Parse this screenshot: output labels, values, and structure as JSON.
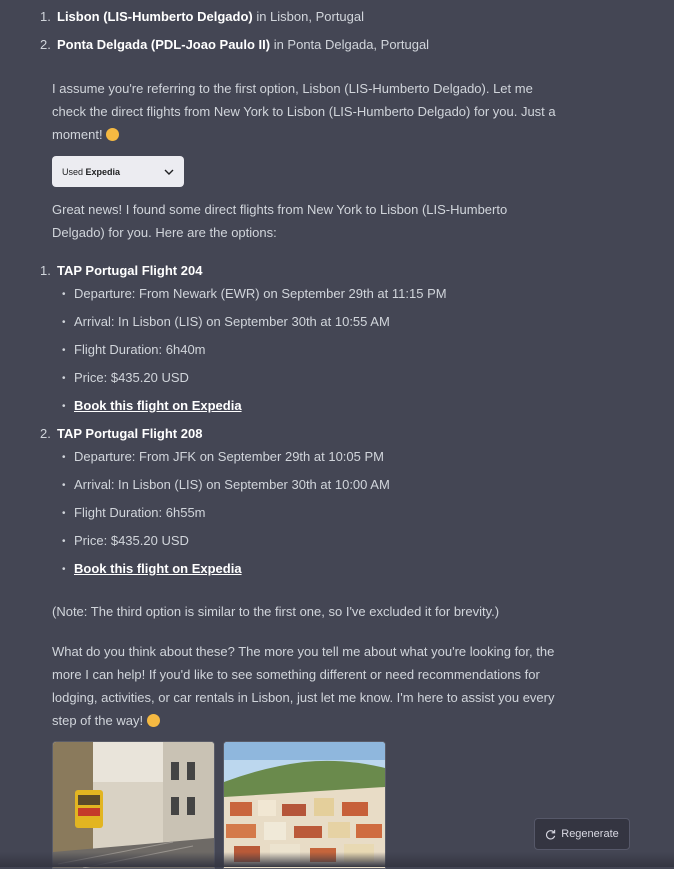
{
  "airports": [
    {
      "num": "1.",
      "name": "Lisbon (LIS-Humberto Delgado)",
      "location": " in Lisbon, Portugal"
    },
    {
      "num": "2.",
      "name": "Ponta Delgada (PDL-Joao Paulo II)",
      "location": " in Ponta Delgada, Portugal"
    }
  ],
  "assume_text": "I assume you're referring to the first option, Lisbon (LIS-Humberto Delgado). Let me check the direct flights from New York to Lisbon (LIS-Humberto Delgado) for you. Just a moment!",
  "plugin": {
    "used": "Used",
    "name": "Expedia"
  },
  "found_text": "Great news! I found some direct flights from New York to Lisbon (LIS-Humberto Delgado) for you. Here are the options:",
  "flights": [
    {
      "num": "1.",
      "title": "TAP Portugal Flight 204",
      "departure": "Departure: From Newark (EWR) on September 29th at 11:15 PM",
      "arrival": "Arrival: In Lisbon (LIS) on September 30th at 10:55 AM",
      "duration": "Flight Duration: 6h40m",
      "price": "Price: $435.20 USD",
      "link": "Book this flight on Expedia"
    },
    {
      "num": "2.",
      "title": "TAP Portugal Flight 208",
      "departure": "Departure: From JFK on September 29th at 10:05 PM",
      "arrival": "Arrival: In Lisbon (LIS) on September 30th at 10:00 AM",
      "duration": "Flight Duration: 6h55m",
      "price": "Price: $435.20 USD",
      "link": "Book this flight on Expedia"
    }
  ],
  "note_text": "(Note: The third option is similar to the first one, so I've excluded it for brevity.)",
  "closing_text": "What do you think about these? The more you tell me about what you're looking for, the more I can help! If you'd like to see something different or need recommendations for lodging, activities, or car rentals in Lisbon, just let me know. I'm here to assist you every step of the way!",
  "regenerate_label": "Regenerate",
  "colors": {
    "background": "#444654",
    "text": "#d1d5db",
    "plugin_bg": "#ececf1",
    "button_bg": "#343541"
  },
  "icons": {
    "chevron": "chevron-down-icon",
    "regenerate": "refresh-icon",
    "emoji": "smiling-face-icon"
  }
}
